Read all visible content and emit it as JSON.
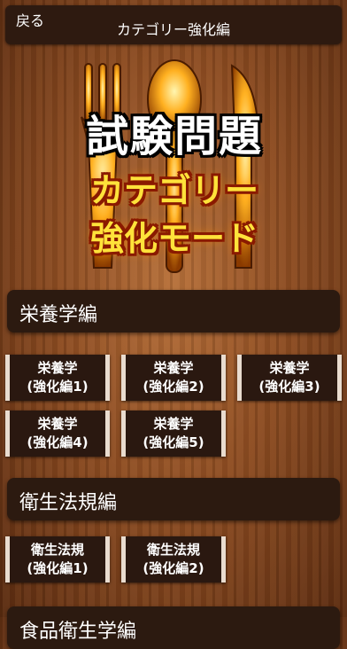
{
  "nav": {
    "back_label": "戻る",
    "title": "カテゴリー強化編"
  },
  "hero": {
    "line1": "試験問題",
    "line2": "カテゴリー",
    "line3": "強化モード"
  },
  "sections": [
    {
      "title": "栄養学編",
      "buttons": [
        "栄養学\n(強化編1)",
        "栄養学\n(強化編2)",
        "栄養学\n(強化編3)",
        "栄養学\n(強化編4)",
        "栄養学\n(強化編5)"
      ]
    },
    {
      "title": "衛生法規編",
      "buttons": [
        "衛生法規\n(強化編1)",
        "衛生法規\n(強化編2)"
      ]
    },
    {
      "title": "食品衛生学編"
    }
  ],
  "colors": {
    "header_bg": "#2c1a10",
    "hero_text": "#ffe23a",
    "accent_glow": "#ff8a00"
  }
}
